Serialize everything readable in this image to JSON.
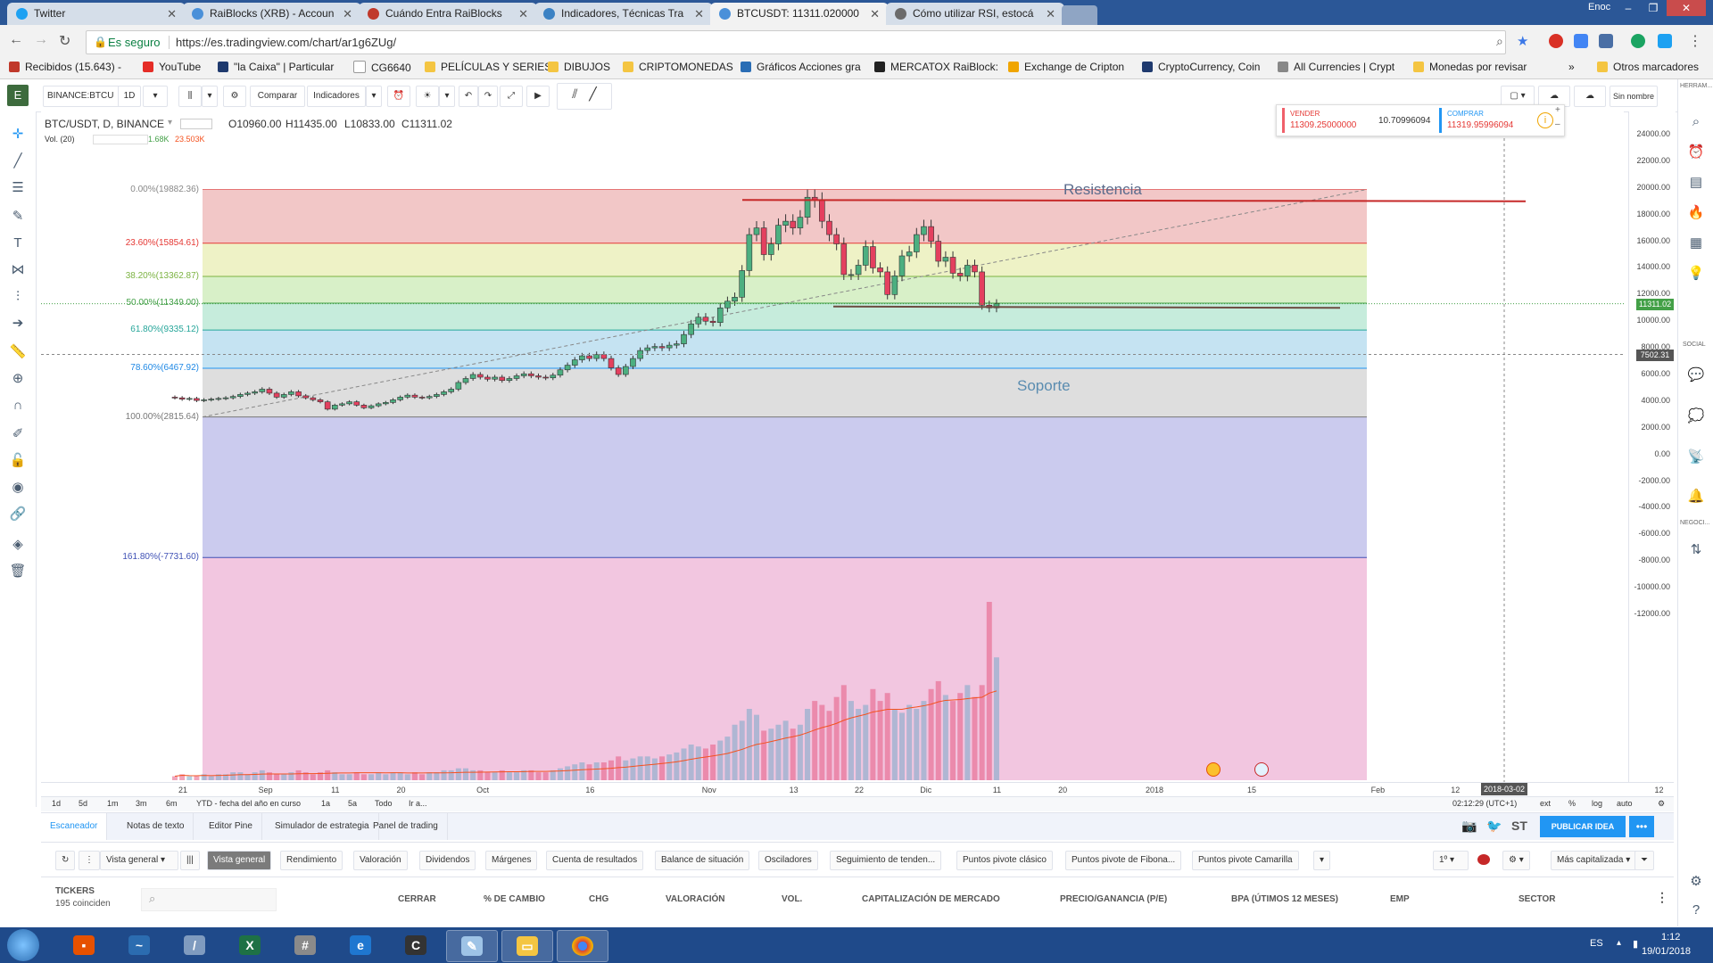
{
  "browser": {
    "tabs": [
      {
        "label": "Twitter",
        "color": "#1da1f2"
      },
      {
        "label": "RaiBlocks (XRB) - Accoun",
        "color": "#4a90d9"
      },
      {
        "label": "Cuándo Entra RaiBlocks",
        "color": "#c0392b"
      },
      {
        "label": "Indicadores, Técnicas Tra",
        "color": "#3b82c4"
      },
      {
        "label": "BTCUSDT: 11311.020000",
        "color": "#4a90d9"
      },
      {
        "label": "Cómo utilizar RSI, estocá",
        "color": "#6b6b6b"
      }
    ],
    "user": "Enoc",
    "secure_label": "Es seguro",
    "url": "https://es.tradingview.com/chart/ar1g6ZUg/"
  },
  "bookmarks": [
    {
      "label": "Recibidos (15.643) -",
      "color": "#c0392b"
    },
    {
      "label": "YouTube",
      "color": "#e52d27"
    },
    {
      "label": "\"la Caixa\" | Particular",
      "color": "#1f3a6e"
    },
    {
      "label": "CG6640",
      "color": "#999999"
    },
    {
      "label": "PELÍCULAS Y SERIES",
      "color": "#f4c542"
    },
    {
      "label": "DIBUJOS",
      "color": "#f4c542"
    },
    {
      "label": "CRIPTOMONEDAS",
      "color": "#f4c542"
    },
    {
      "label": "Gráficos Acciones gra",
      "color": "#2a6db5"
    },
    {
      "label": "MERCATOX RaiBlock:",
      "color": "#222222"
    },
    {
      "label": "Exchange de Cripton",
      "color": "#f0a500"
    },
    {
      "label": "CryptoCurrency, Coin",
      "color": "#1f3a6e"
    },
    {
      "label": "All Currencies | Crypt",
      "color": "#888888"
    },
    {
      "label": "Monedas por revisar",
      "color": "#f4c542"
    }
  ],
  "bookmarks_more": "»",
  "bookmarks_other": "Otros marcadores",
  "toolbar": {
    "symbol": "BINANCE:BTCU",
    "interval": "1D",
    "compare": "Comparar",
    "indicators": "Indicadores",
    "layout_name": "Sin nombre"
  },
  "right_panel": {
    "label_top": "HERRAM...",
    "label_social": "SOCIAL",
    "label_negoci": "NEGOCI..."
  },
  "chart": {
    "title": "BTC/USDT, D, BINANCE",
    "ohlc": {
      "o": "O10960.00",
      "h": "H11435.00",
      "l": "L10833.00",
      "c": "C11311.02"
    },
    "vol_label": "Vol. (20)",
    "vol_values": [
      "1.68K",
      "23.503K"
    ],
    "trade_widget": {
      "sell_label": "VENDER",
      "sell_price": "11309.25000000",
      "spread": "10.70996094",
      "buy_label": "COMPRAR",
      "buy_price": "11319.95996094"
    },
    "resistencia": "Resistencia",
    "soporte": "Soporte",
    "current_price": "11311.02",
    "crosshair_price": "7502.31",
    "crosshair_date": "2018-03-02",
    "fib_levels": [
      {
        "label": "0.00%(19882.36)",
        "price": 19882.36,
        "fill": "#f2c7c7",
        "line": "#e57373",
        "labelcolor": "#888888"
      },
      {
        "label": "23.60%(15854.61)",
        "price": 15854.61,
        "fill": "#eef2c6",
        "line": "#e53935",
        "labelcolor": "#e53935"
      },
      {
        "label": "38.20%(13362.87)",
        "price": 13362.87,
        "fill": "#d8f0c8",
        "line": "#7cb342",
        "labelcolor": "#7cb342"
      },
      {
        "label": "50.00%(11349.00)",
        "price": 11349.0,
        "fill": "#c6ecdc",
        "line": "#43a047",
        "labelcolor": "#43a047"
      },
      {
        "label": "61.80%(9335.12)",
        "price": 9335.12,
        "fill": "#c5e3f2",
        "line": "#26a69a",
        "labelcolor": "#26a69a"
      },
      {
        "label": "78.60%(6467.92)",
        "price": 6467.92,
        "fill": "#dedede",
        "line": "#2196f3",
        "labelcolor": "#1e88e5"
      },
      {
        "label": "100.00%(2815.64)",
        "price": 2815.64,
        "fill": "#cbcbee",
        "line": "#777777",
        "labelcolor": "#777777"
      },
      {
        "label": "161.80%(-7731.60)",
        "price": -7731.6,
        "fill": "#f2c6e0",
        "line": "#3f51b5",
        "labelcolor": "#3f51b5"
      }
    ],
    "price_ticks": [
      "24000.00",
      "22000.00",
      "20000.00",
      "18000.00",
      "16000.00",
      "14000.00",
      "12000.00",
      "10000.00",
      "8000.00",
      "6000.00",
      "4000.00",
      "2000.00",
      "0.00",
      "-2000.00",
      "-4000.00",
      "-6000.00",
      "-8000.00",
      "-10000.00",
      "-12000.00"
    ],
    "time_ticks": [
      {
        "label": "21",
        "day": 0
      },
      {
        "label": "Sep",
        "day": 11
      },
      {
        "label": "11",
        "day": 21
      },
      {
        "label": "20",
        "day": 30
      },
      {
        "label": "Oct",
        "day": 41
      },
      {
        "label": "16",
        "day": 56
      },
      {
        "label": "Nov",
        "day": 72
      },
      {
        "label": "13",
        "day": 84
      },
      {
        "label": "22",
        "day": 93
      },
      {
        "label": "Dic",
        "day": 102
      },
      {
        "label": "11",
        "day": 112
      },
      {
        "label": "20",
        "day": 121
      },
      {
        "label": "2018",
        "day": 133
      },
      {
        "label": "15",
        "day": 147
      },
      {
        "label": "Feb",
        "day": 164
      },
      {
        "label": "12",
        "day": 175
      },
      {
        "label": "12",
        "day": 203
      },
      {
        "label": "2",
        "day": 212
      }
    ]
  },
  "chart_data": {
    "type": "candlestick",
    "candles": [
      [
        4300,
        4250
      ],
      [
        4250,
        4150
      ],
      [
        4150,
        4200
      ],
      [
        4200,
        4050
      ],
      [
        4050,
        4100
      ],
      [
        4100,
        4150
      ],
      [
        4150,
        4200
      ],
      [
        4200,
        4250
      ],
      [
        4250,
        4350
      ],
      [
        4350,
        4500
      ],
      [
        4500,
        4600
      ],
      [
        4600,
        4700
      ],
      [
        4700,
        4900
      ],
      [
        4900,
        4600
      ],
      [
        4600,
        4300
      ],
      [
        4300,
        4500
      ],
      [
        4500,
        4700
      ],
      [
        4700,
        4400
      ],
      [
        4400,
        4250
      ],
      [
        4250,
        4100
      ],
      [
        4100,
        3950
      ],
      [
        3950,
        3400
      ],
      [
        3400,
        3700
      ],
      [
        3700,
        3800
      ],
      [
        3800,
        3950
      ],
      [
        3950,
        3700
      ],
      [
        3700,
        3500
      ],
      [
        3500,
        3650
      ],
      [
        3650,
        3800
      ],
      [
        3800,
        3900
      ],
      [
        3900,
        4100
      ],
      [
        4100,
        4300
      ],
      [
        4300,
        4450
      ],
      [
        4450,
        4300
      ],
      [
        4300,
        4250
      ],
      [
        4250,
        4350
      ],
      [
        4350,
        4500
      ],
      [
        4500,
        4700
      ],
      [
        4700,
        4900
      ],
      [
        4900,
        5400
      ],
      [
        5400,
        5700
      ],
      [
        5700,
        6000
      ],
      [
        6000,
        5800
      ],
      [
        5800,
        5650
      ],
      [
        5650,
        5800
      ],
      [
        5800,
        5550
      ],
      [
        5550,
        5700
      ],
      [
        5700,
        5900
      ],
      [
        5900,
        6050
      ],
      [
        6050,
        5900
      ],
      [
        5900,
        5800
      ],
      [
        5800,
        5750
      ],
      [
        5750,
        5950
      ],
      [
        5950,
        6350
      ],
      [
        6350,
        6700
      ],
      [
        6700,
        7100
      ],
      [
        7100,
        7400
      ],
      [
        7400,
        7200
      ],
      [
        7200,
        7500
      ],
      [
        7500,
        7200
      ],
      [
        7200,
        6500
      ],
      [
        6500,
        6000
      ],
      [
        6000,
        6600
      ],
      [
        6600,
        7200
      ],
      [
        7200,
        7800
      ],
      [
        7800,
        8000
      ],
      [
        8000,
        8100
      ],
      [
        8100,
        8000
      ],
      [
        8000,
        8200
      ],
      [
        8200,
        8300
      ],
      [
        8300,
        9000
      ],
      [
        9000,
        9800
      ],
      [
        9800,
        10300
      ],
      [
        10300,
        10000
      ],
      [
        10000,
        9900
      ],
      [
        9900,
        11000
      ],
      [
        11000,
        11500
      ],
      [
        11500,
        11800
      ],
      [
        11800,
        13800
      ],
      [
        13800,
        16500
      ],
      [
        16500,
        17000
      ],
      [
        17000,
        15000
      ],
      [
        15000,
        15800
      ],
      [
        15800,
        17200
      ],
      [
        17200,
        17500
      ],
      [
        17500,
        17000
      ],
      [
        17000,
        17800
      ],
      [
        17800,
        19300
      ],
      [
        19300,
        19100
      ],
      [
        19100,
        17500
      ],
      [
        17500,
        16500
      ],
      [
        16500,
        15800
      ],
      [
        15800,
        13500
      ],
      [
        13500,
        13500
      ],
      [
        13500,
        14200
      ],
      [
        14200,
        15600
      ],
      [
        15600,
        14000
      ],
      [
        14000,
        13700
      ],
      [
        13700,
        12000
      ],
      [
        12000,
        13400
      ],
      [
        13400,
        14900
      ],
      [
        14900,
        15200
      ],
      [
        15200,
        16500
      ],
      [
        16500,
        17100
      ],
      [
        17100,
        16000
      ],
      [
        16000,
        14500
      ],
      [
        14500,
        14800
      ],
      [
        14800,
        13600
      ],
      [
        13600,
        13400
      ],
      [
        13400,
        14200
      ],
      [
        14200,
        13700
      ],
      [
        13700,
        11200
      ],
      [
        11200,
        11000
      ],
      [
        11000,
        11311
      ]
    ],
    "volume": [
      0.02,
      0.03,
      0.02,
      0.02,
      0.03,
      0.02,
      0.03,
      0.03,
      0.04,
      0.04,
      0.03,
      0.04,
      0.05,
      0.04,
      0.03,
      0.03,
      0.04,
      0.05,
      0.04,
      0.03,
      0.04,
      0.05,
      0.04,
      0.03,
      0.03,
      0.04,
      0.03,
      0.03,
      0.04,
      0.03,
      0.04,
      0.04,
      0.03,
      0.04,
      0.03,
      0.04,
      0.04,
      0.05,
      0.05,
      0.06,
      0.06,
      0.05,
      0.05,
      0.04,
      0.04,
      0.05,
      0.04,
      0.04,
      0.05,
      0.05,
      0.04,
      0.04,
      0.05,
      0.06,
      0.07,
      0.08,
      0.09,
      0.08,
      0.09,
      0.09,
      0.1,
      0.12,
      0.1,
      0.11,
      0.12,
      0.12,
      0.11,
      0.12,
      0.13,
      0.14,
      0.16,
      0.18,
      0.17,
      0.16,
      0.18,
      0.2,
      0.22,
      0.28,
      0.3,
      0.36,
      0.33,
      0.25,
      0.26,
      0.28,
      0.3,
      0.26,
      0.28,
      0.36,
      0.4,
      0.38,
      0.35,
      0.42,
      0.48,
      0.4,
      0.36,
      0.38,
      0.46,
      0.4,
      0.44,
      0.36,
      0.34,
      0.38,
      0.36,
      0.4,
      0.46,
      0.5,
      0.43,
      0.4,
      0.44,
      0.48,
      0.42,
      0.48,
      0.9,
      0.62
    ],
    "volume_max_label": "23.503K",
    "ylim": [
      -14000,
      25000
    ]
  },
  "bottom": {
    "ranges": [
      "1d",
      "5d",
      "1m",
      "3m",
      "6m",
      "YTD - fecha del año en curso",
      "1a",
      "5a",
      "Todo",
      "Ir a..."
    ],
    "timestamp": "02:12:29 (UTC+1)",
    "axis_opts": [
      "ext",
      "%",
      "log",
      "auto"
    ],
    "tabs": [
      "Escaneador",
      "Notas de texto",
      "Editor Pine",
      "Simulador de estrategia",
      "Panel de trading"
    ],
    "publish": "PUBLICAR IDEA",
    "st": "ST",
    "scanner_views": [
      "Vista general",
      "Vista general",
      "Rendimiento",
      "Valoración",
      "Dividendos",
      "Márgenes",
      "Cuenta de resultados",
      "Balance de situación",
      "Osciladores",
      "Seguimiento de tenden...",
      "Puntos pivote clásico",
      "Puntos pivote de Fibona...",
      "Puntos pivote Camarilla"
    ],
    "interval_select": "1º",
    "sort_select": "Más capitalizada",
    "tickers_label": "TICKERS",
    "tickers_count": "195 coinciden",
    "columns": [
      "CERRAR",
      "% DE CAMBIO",
      "CHG",
      "VALORACIÓN",
      "VOL.",
      "CAPITALIZACIÓN DE MERCADO",
      "PRECIO/GANANCIA (P/E)",
      "BPA (ÚTIMOS 12 MESES)",
      "EMP",
      "SECTOR"
    ]
  },
  "taskbar": {
    "lang": "ES",
    "time": "1:12",
    "date": "19/01/2018"
  }
}
